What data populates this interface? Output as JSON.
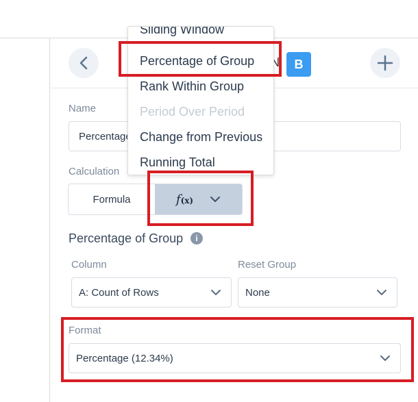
{
  "dropdown": {
    "items": [
      {
        "label": "Sliding Window",
        "disabled": false
      },
      {
        "label": "Percentage of Group",
        "disabled": false
      },
      {
        "label": "Rank Within Group",
        "disabled": false
      },
      {
        "label": "Period Over Period",
        "disabled": true
      },
      {
        "label": "Change from Previous",
        "disabled": false
      },
      {
        "label": "Running Total",
        "disabled": false
      }
    ]
  },
  "header": {
    "back_icon": "chevron-left-icon",
    "add_icon": "plus-icon",
    "hidden_letter": "N",
    "chip_letter": "B",
    "chip_color": "#3b9cf2"
  },
  "name": {
    "label": "Name",
    "value": "Percentage"
  },
  "calculation": {
    "label": "Calculation",
    "formula_option": "Formula",
    "function_option_icon": "f(x)",
    "function_option_main": "f",
    "function_option_sub": "(x)",
    "chevron_icon": "chevron-down-icon"
  },
  "group_section": {
    "title": "Percentage of Group",
    "info_icon": "i"
  },
  "column": {
    "label": "Column",
    "value": "A: Count of Rows"
  },
  "reset_group": {
    "label": "Reset Group",
    "value": "None"
  },
  "format": {
    "label": "Format",
    "value": "Percentage (12.34%)"
  },
  "highlight_color": "#d71d24"
}
